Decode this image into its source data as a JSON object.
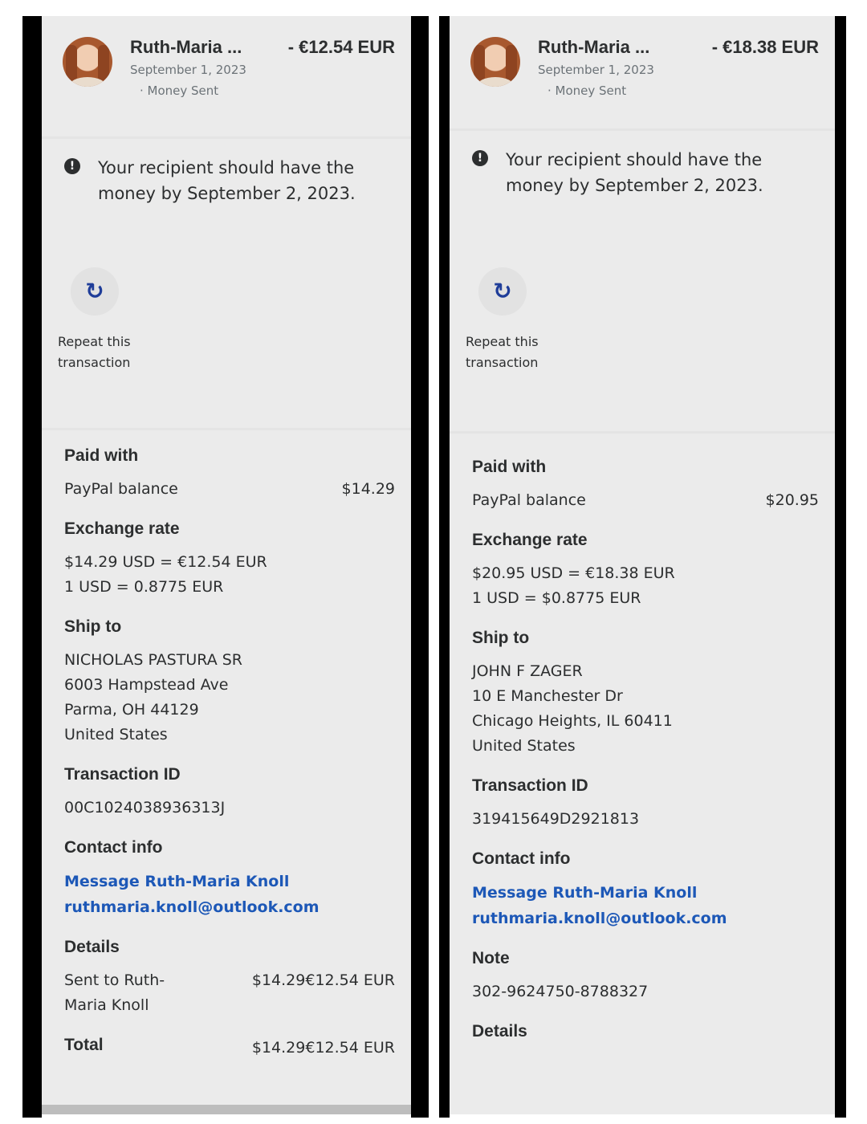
{
  "left": {
    "name": "Ruth-Maria ...",
    "amount": "- €12.54 EUR",
    "date": "September 1, 2023",
    "type": "· Money Sent",
    "notice": "Your recipient should have the money by September 2, 2023.",
    "repeat_label": "Repeat this transaction",
    "paid_with": {
      "heading": "Paid with",
      "method": "PayPal balance",
      "value": "$14.29"
    },
    "exchange": {
      "heading": "Exchange rate",
      "line1": "$14.29 USD = €12.54 EUR",
      "line2": "1 USD = 0.8775 EUR"
    },
    "ship_to": {
      "heading": "Ship to",
      "line1": "NICHOLAS PASTURA SR",
      "line2": "6003 Hampstead Ave",
      "line3": "Parma, OH 44129",
      "line4": "United States"
    },
    "transaction": {
      "heading": "Transaction ID",
      "id": "00C1024038936313J"
    },
    "contact": {
      "heading": "Contact info",
      "message": "Message Ruth-Maria Knoll",
      "email": "ruthmaria.knoll@outlook.com"
    },
    "details": {
      "heading": "Details",
      "sent_to": "Sent to Ruth-Maria Knoll",
      "sent_value": "$14.29€12.54 EUR"
    },
    "total": {
      "label": "Total",
      "value": "$14.29€12.54 EUR"
    }
  },
  "right": {
    "name": "Ruth-Maria ...",
    "amount": "- €18.38 EUR",
    "date": "September 1, 2023",
    "type": "· Money Sent",
    "notice": "Your recipient should have the money by September 2, 2023.",
    "repeat_label": "Repeat this transaction",
    "paid_with": {
      "heading": "Paid with",
      "method": "PayPal balance",
      "value": "$20.95"
    },
    "exchange": {
      "heading": "Exchange rate",
      "line1": "$20.95 USD = €18.38 EUR",
      "line2": "1 USD = $0.8775 EUR"
    },
    "ship_to": {
      "heading": "Ship to",
      "line1": "JOHN F ZAGER",
      "line2": "10 E Manchester Dr",
      "line3": "Chicago Heights, IL 60411",
      "line4": "United States"
    },
    "transaction": {
      "heading": "Transaction ID",
      "id": "319415649D2921813"
    },
    "contact": {
      "heading": "Contact info",
      "message": "Message Ruth-Maria Knoll",
      "email": "ruthmaria.knoll@outlook.com"
    },
    "note": {
      "heading": "Note",
      "text": "302-9624750-8788327"
    },
    "details": {
      "heading": "Details"
    }
  },
  "icons": {
    "info": "info-icon",
    "repeat": "refresh-icon"
  },
  "colors": {
    "link": "#1d58b7",
    "panel_bg": "#ebebeb",
    "frame": "#000000"
  }
}
